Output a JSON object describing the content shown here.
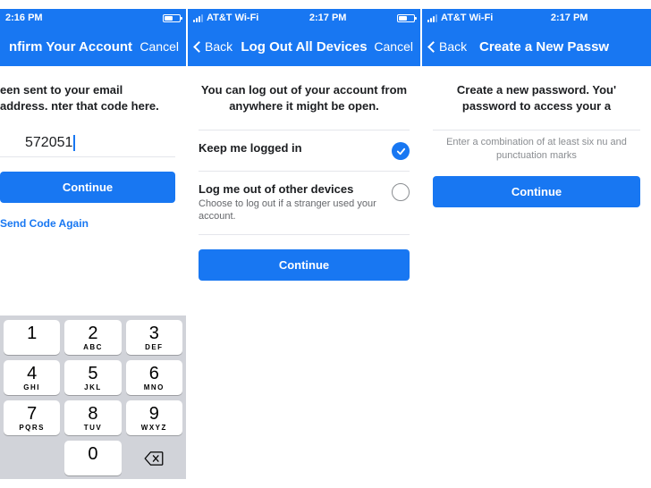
{
  "screens": [
    {
      "status": {
        "time": "2:16 PM",
        "carrier": "",
        "wifi": false
      },
      "nav": {
        "title": "nfirm Your Account",
        "back": "",
        "cancel": "Cancel"
      },
      "headline": "een sent to your email address. nter that code here.",
      "code": "572051",
      "continue": "Continue",
      "link": "Send Code Again",
      "keypad": [
        [
          {
            "n": "1",
            "l": ""
          },
          {
            "n": "2",
            "l": "ABC"
          },
          {
            "n": "3",
            "l": "DEF"
          }
        ],
        [
          {
            "n": "4",
            "l": "GHI"
          },
          {
            "n": "5",
            "l": "JKL"
          },
          {
            "n": "6",
            "l": "MNO"
          }
        ],
        [
          {
            "n": "7",
            "l": "PQRS"
          },
          {
            "n": "8",
            "l": "TUV"
          },
          {
            "n": "9",
            "l": "WXYZ"
          }
        ],
        [
          {
            "n": "",
            "l": ""
          },
          {
            "n": "0",
            "l": ""
          },
          {
            "n": "del",
            "l": ""
          }
        ]
      ]
    },
    {
      "status": {
        "time": "2:17 PM",
        "carrier": "AT&T Wi-Fi"
      },
      "nav": {
        "title": "Log Out All Devices",
        "back": "Back",
        "cancel": "Cancel"
      },
      "headline": "You can log out of your account from anywhere it might be open.",
      "options": [
        {
          "title": "Keep me logged in",
          "sub": "",
          "selected": true
        },
        {
          "title": "Log me out of other devices",
          "sub": "Choose to log out if a stranger used your account.",
          "selected": false
        }
      ],
      "continue": "Continue"
    },
    {
      "status": {
        "time": "2:17 PM",
        "carrier": "AT&T Wi-Fi"
      },
      "nav": {
        "title": "Create a New Passw",
        "back": "Back",
        "cancel": ""
      },
      "headline": "Create a new password. You' password to access your a",
      "hint": "Enter a combination of at least six nu and punctuation marks",
      "continue": "Continue"
    }
  ]
}
